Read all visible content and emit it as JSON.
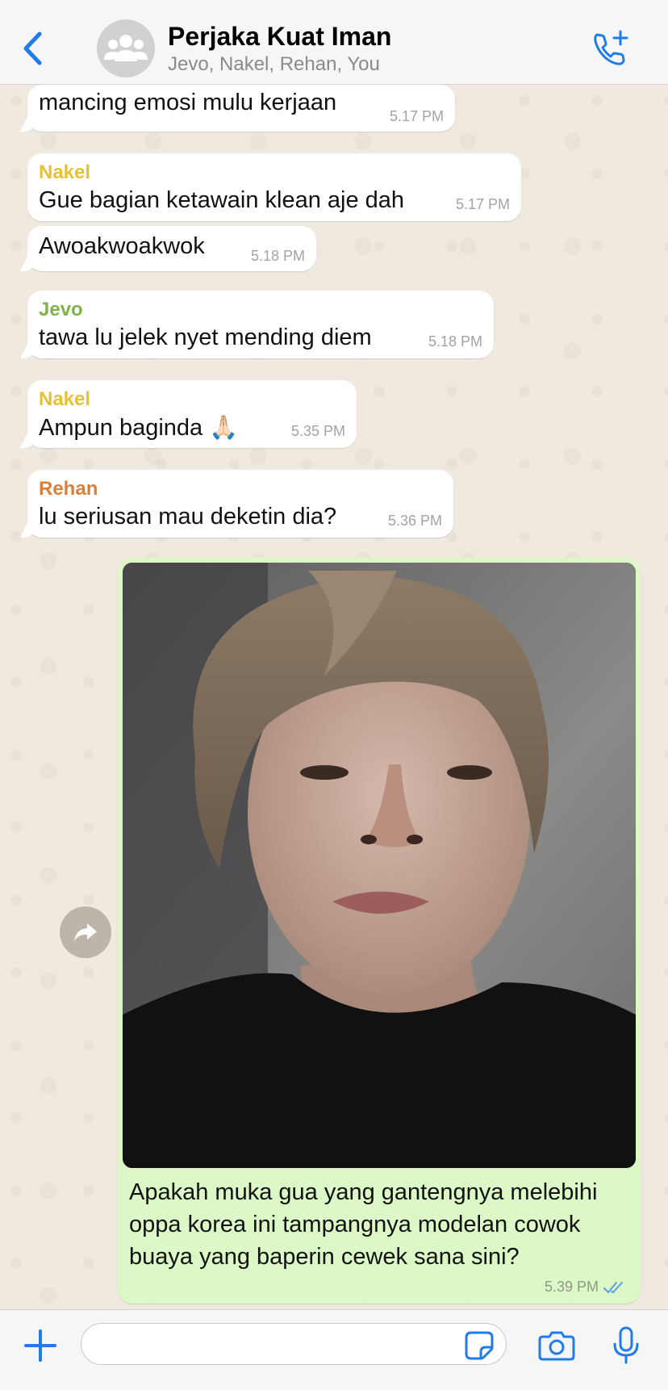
{
  "header": {
    "title": "Perjaka Kuat Iman",
    "subtitle": "Jevo, Nakel, Rehan, You",
    "back_icon": "chevron-left-icon",
    "avatar_icon": "group-icon",
    "call_icon": "phone-add-icon"
  },
  "colors": {
    "accent": "#1f7ce8",
    "nakel": "#e4c234",
    "jevo": "#7fb347",
    "rehan": "#d9813a",
    "outgoing_bubble": "#dcf8c6",
    "tick": "#5a9fe6"
  },
  "messages": [
    {
      "sender": "",
      "text": "mancing emosi mulu kerjaan",
      "time": "5.17 PM"
    },
    {
      "sender": "Nakel",
      "text": "Gue bagian ketawain klean aje dah",
      "time": "5.17 PM"
    },
    {
      "sender": "",
      "text": "Awoakwoakwok",
      "time": "5.18 PM"
    },
    {
      "sender": "Jevo",
      "text": "tawa lu jelek nyet mending diem",
      "time": "5.18 PM"
    },
    {
      "sender": "Nakel",
      "text": "Ampun baginda 🙏🏻",
      "time": "5.35 PM"
    },
    {
      "sender": "Rehan",
      "text": "lu seriusan mau deketin dia?",
      "time": "5.36 PM"
    }
  ],
  "outgoing": {
    "caption": "Apakah muka gua yang gantengnya melebihi oppa korea ini tampangnya modelan cowok buaya yang baperin cewek sana sini?",
    "time": "5.39 PM",
    "status_icon": "double-check-icon"
  },
  "input": {
    "placeholder": "",
    "plus_icon": "plus-icon",
    "sticker_icon": "sticker-icon",
    "camera_icon": "camera-icon",
    "mic_icon": "microphone-icon"
  }
}
